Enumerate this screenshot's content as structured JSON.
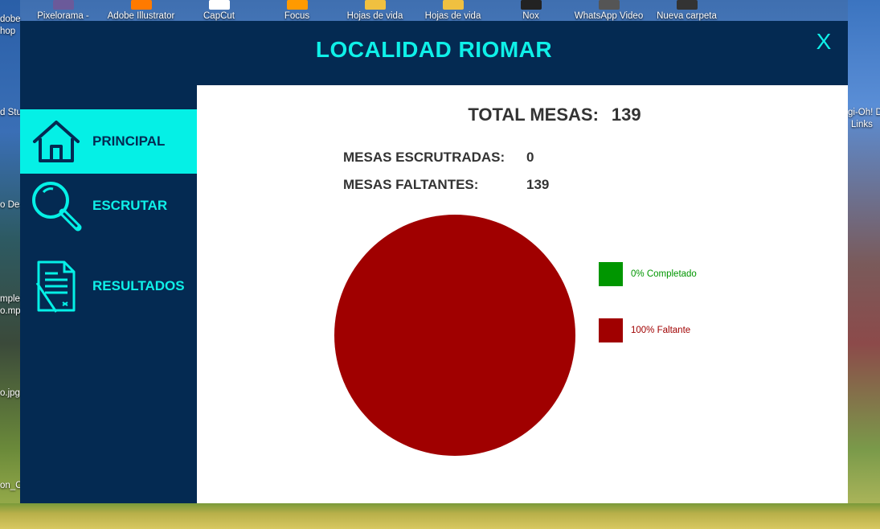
{
  "desktop": {
    "top_icons": [
      {
        "label": "Pixelorama -",
        "color": "#6b5a9a"
      },
      {
        "label": "Adobe Illustrator",
        "color": "#ff7a00"
      },
      {
        "label": "CapCut",
        "color": "#ffffff"
      },
      {
        "label": "Focus",
        "color": "#ff9a00"
      },
      {
        "label": "Hojas de vida",
        "color": "#f0c040"
      },
      {
        "label": "Hojas de vida",
        "color": "#f0c040"
      },
      {
        "label": "Nox",
        "color": "#222222"
      },
      {
        "label": "WhatsApp Video",
        "color": "#555555"
      },
      {
        "label": "Nueva carpeta",
        "color": "#333333"
      }
    ],
    "left_labels": [
      "dobe",
      "hop",
      "d Stu",
      "o Des",
      "mple",
      "o.mp",
      "o.jpg",
      "on_C"
    ],
    "right_labels": [
      "gi-Oh! D",
      "Links"
    ]
  },
  "window": {
    "title": "LOCALIDAD RIOMAR",
    "close_label": "X",
    "accent": "#05f0e6",
    "background": "#042a52"
  },
  "nav": [
    {
      "label": "PRINCIPAL",
      "icon": "home-icon",
      "active": true
    },
    {
      "label": "ESCRUTAR",
      "icon": "search-icon",
      "active": false
    },
    {
      "label": "RESULTADOS",
      "icon": "document-icon",
      "active": false
    }
  ],
  "summary": {
    "total_label": "TOTAL MESAS:",
    "total_value": "139",
    "scrutinized_label": "MESAS ESCRUTRADAS:",
    "scrutinized_value": "0",
    "remaining_label": "MESAS FALTANTES:",
    "remaining_value": "139"
  },
  "chart_data": {
    "type": "pie",
    "categories": [
      "Completado",
      "Faltante"
    ],
    "values": [
      0,
      100
    ],
    "colors": [
      "#009600",
      "#a00000"
    ],
    "legend": [
      "0% Completado",
      "100% Faltante"
    ],
    "legend_position": "right"
  }
}
